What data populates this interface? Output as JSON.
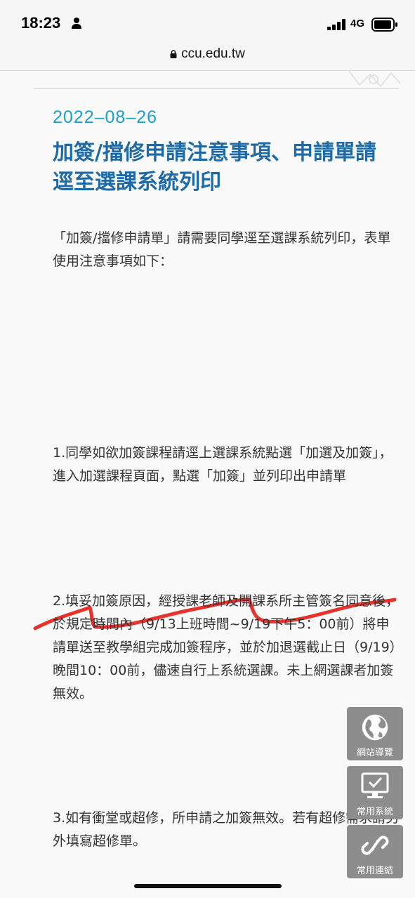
{
  "status_bar": {
    "time": "18:23",
    "network": "4G",
    "icons": [
      "person-icon",
      "signal-bars-icon",
      "battery-icon"
    ]
  },
  "url_bar": {
    "domain": "ccu.edu.tw",
    "icon": "lock-icon"
  },
  "article": {
    "date": "2022–08–26",
    "title": "加簽/擋修申請注意事項、申請單請逕至選課系統列印",
    "intro": "「加簽/擋修申請單」請需要同學逕至選課系統列印，表單使用注意事項如下：",
    "item1": "1.同學如欲加簽課程請逕上選課系統點選「加選及加簽」，進入加選課程頁面，點選「加簽」並列印出申請單",
    "item2": "2.填妥加簽原因，經授課老師及開課系所主管簽名同意後，於規定時間內（9/13上班時間~9/19下午5：00前）將申請單送至教學組完成加簽程序，並於加退選截止日（9/19）晚間10：00前，儘速自行上系統選課。未上網選課者加簽無效。",
    "item3": "3.如有衝堂或超修，所申請之加簽無效。若有超修需求請另外填寫超修單。"
  },
  "floating_menu": {
    "site_guide": "網站導覽",
    "common_systems": "常用系統",
    "common_links": "常用連結"
  },
  "colors": {
    "date": "#1ea0c8",
    "title": "#1e6aa6",
    "scribble": "#e8322b",
    "float_button": "#8d8d8d"
  }
}
